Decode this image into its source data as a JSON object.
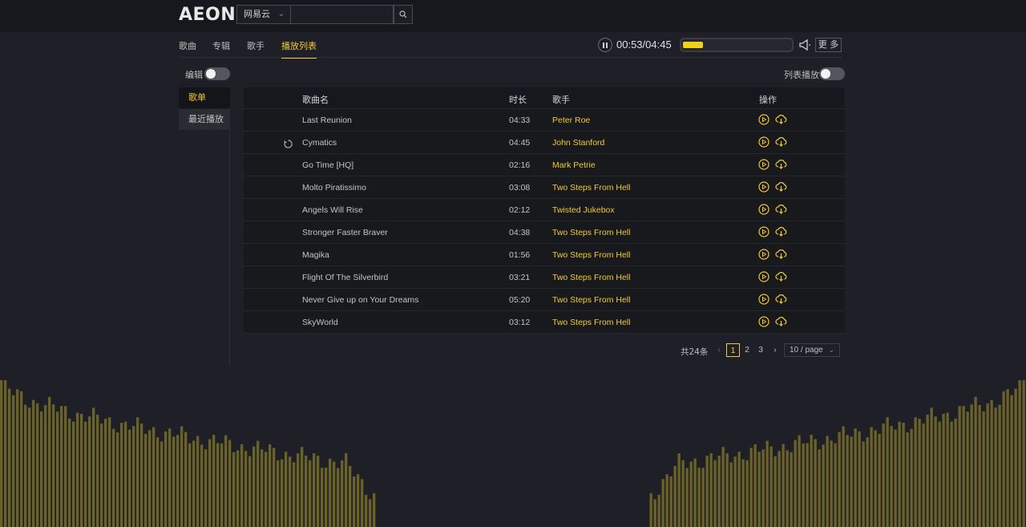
{
  "app": {
    "logo": "AEON"
  },
  "search": {
    "source": "网易云",
    "placeholder": ""
  },
  "tabs": [
    {
      "label": "歌曲",
      "active": false
    },
    {
      "label": "专辑",
      "active": false
    },
    {
      "label": "歌手",
      "active": false
    },
    {
      "label": "播放列表",
      "active": true
    }
  ],
  "player": {
    "time": "00:53/04:45",
    "progress": 0.19,
    "more_label": "更 多"
  },
  "controls": {
    "edit_label": "编辑",
    "edit_on": false,
    "loop_label": "列表播放",
    "loop_on": false
  },
  "sidebar": {
    "items": [
      {
        "label": "歌单",
        "active": true
      },
      {
        "label": "最近播放",
        "active": false
      }
    ]
  },
  "table": {
    "headers": {
      "name": "歌曲名",
      "duration": "时长",
      "artist": "歌手",
      "ops": "操作"
    },
    "rows": [
      {
        "name": "Last Reunion",
        "duration": "04:33",
        "artist": "Peter Roe",
        "loading": false
      },
      {
        "name": "Cymatics",
        "duration": "04:45",
        "artist": "John Stanford",
        "loading": true
      },
      {
        "name": "Go Time [HQ]",
        "duration": "02:16",
        "artist": "Mark Petrie",
        "loading": false
      },
      {
        "name": "Molto Piratissimo",
        "duration": "03:08",
        "artist": "Two Steps From Hell",
        "loading": false
      },
      {
        "name": "Angels Will Rise",
        "duration": "02:12",
        "artist": "Twisted Jukebox",
        "loading": false
      },
      {
        "name": "Stronger Faster Braver",
        "duration": "04:38",
        "artist": "Two Steps From Hell",
        "loading": false
      },
      {
        "name": "Magika",
        "duration": "01:56",
        "artist": "Two Steps From Hell",
        "loading": false
      },
      {
        "name": "Flight Of The Silverbird",
        "duration": "03:21",
        "artist": "Two Steps From Hell",
        "loading": false
      },
      {
        "name": "Never Give up on Your Dreams",
        "duration": "05:20",
        "artist": "Two Steps From Hell",
        "loading": false
      },
      {
        "name": "SkyWorld",
        "duration": "03:12",
        "artist": "Two Steps From Hell",
        "loading": false
      }
    ]
  },
  "pagination": {
    "total": "共24条",
    "pages": [
      "1",
      "2",
      "3"
    ],
    "current": "1",
    "page_size": "10 / page"
  },
  "colors": {
    "accent": "#f0c93b",
    "background": "#1f2027",
    "visualizer": "#6b6228"
  }
}
